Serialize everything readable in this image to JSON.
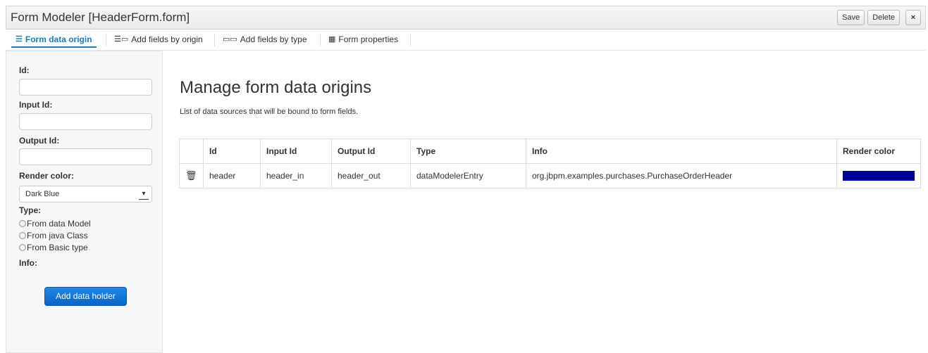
{
  "window": {
    "title": "Form Modeler [HeaderForm.form]",
    "buttons": {
      "save": "Save",
      "delete": "Delete",
      "close": "×"
    }
  },
  "tabs": [
    {
      "label": "Form data origin",
      "icon": "list-icon",
      "active": true
    },
    {
      "label": "Add fields by origin",
      "icon": "fields-origin-icon",
      "active": false
    },
    {
      "label": "Add fields by type",
      "icon": "fields-type-icon",
      "active": false
    },
    {
      "label": "Form properties",
      "icon": "properties-icon",
      "active": false
    }
  ],
  "sidebar": {
    "id_label": "Id:",
    "id_value": "",
    "input_id_label": "Input Id:",
    "input_id_value": "",
    "output_id_label": "Output Id:",
    "output_id_value": "",
    "render_color_label": "Render color:",
    "render_color_value": "Dark Blue",
    "type_label": "Type:",
    "type_options": [
      "From data Model",
      "From java Class",
      "From Basic type"
    ],
    "info_label": "Info:",
    "add_button": "Add data holder"
  },
  "main": {
    "title": "Manage form data origins",
    "description": "List of data sources that will be bound to form fields.",
    "columns": [
      "Id",
      "Input Id",
      "Output Id",
      "Type",
      "Info",
      "Render color"
    ],
    "rows": [
      {
        "id": "header",
        "input_id": "header_in",
        "output_id": "header_out",
        "type": "dataModelerEntry",
        "info": "org.jbpm.examples.purchases.PurchaseOrderHeader",
        "render_color": "#000099"
      }
    ]
  },
  "colors": {
    "accent": "#1a7bbf",
    "primary_button": "#0b63c7",
    "render_dark_blue": "#000099"
  }
}
